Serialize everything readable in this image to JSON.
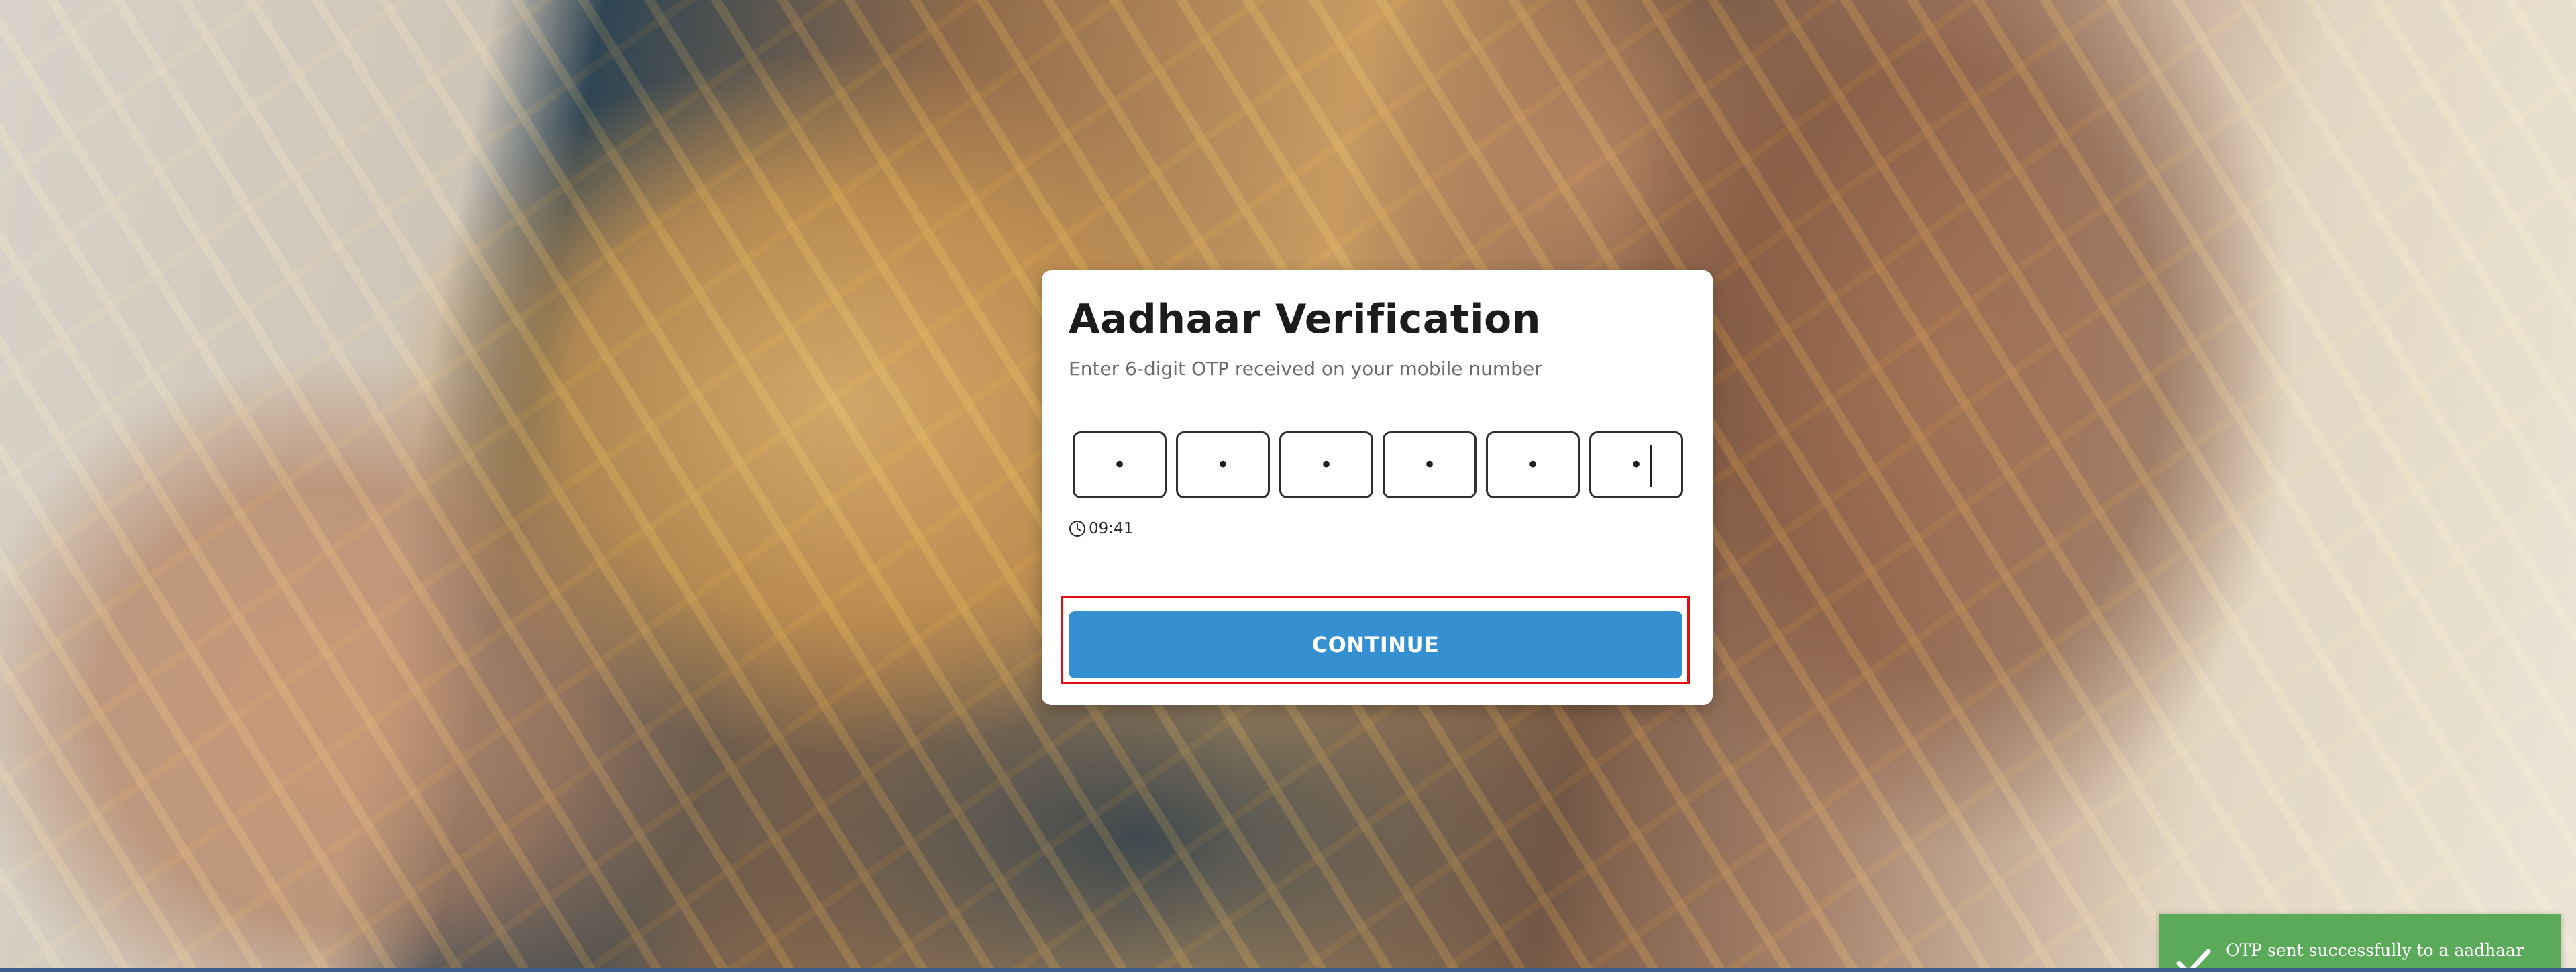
{
  "card": {
    "title": "Aadhaar Verification",
    "subtitle": "Enter 6-digit OTP received on your mobile number",
    "otp_mask": [
      "•",
      "•",
      "•",
      "•",
      "•",
      "•"
    ],
    "timer": "09:41",
    "continue_label": "CONTINUE"
  },
  "toast": {
    "message": "OTP sent successfully to a aadhaar linked mobile number",
    "color": "#5aaa5a",
    "icon": "check-icon"
  },
  "colors": {
    "accent": "#3590d2",
    "highlight": "#e01010"
  }
}
